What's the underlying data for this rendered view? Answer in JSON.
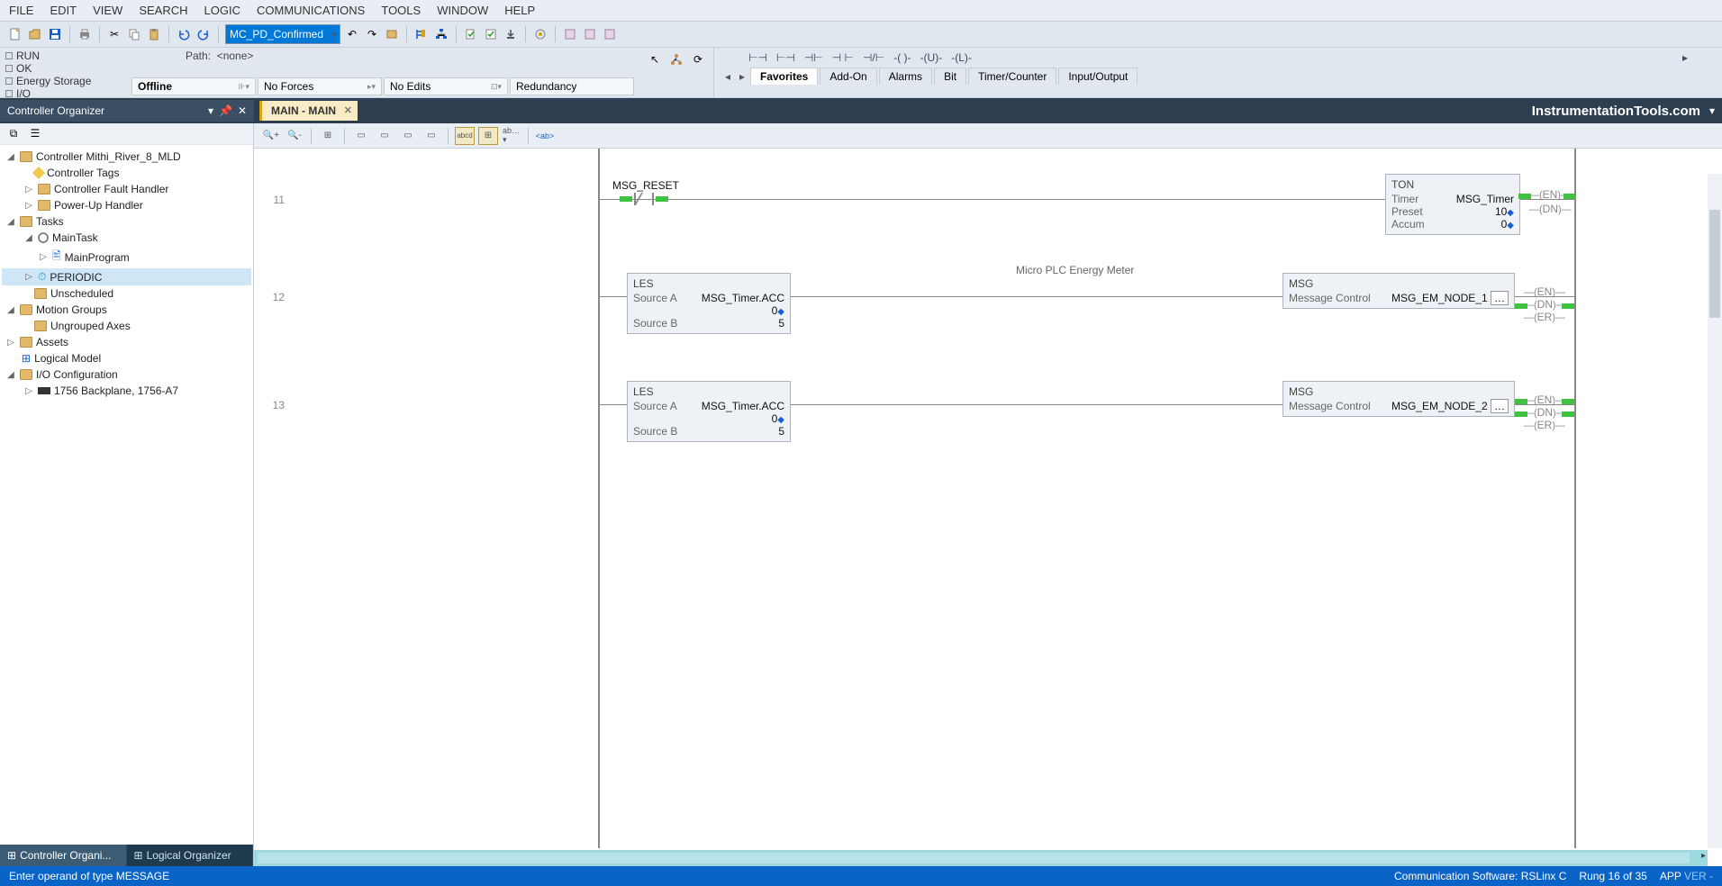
{
  "menu": {
    "items": [
      "FILE",
      "EDIT",
      "VIEW",
      "SEARCH",
      "LOGIC",
      "COMMUNICATIONS",
      "TOOLS",
      "WINDOW",
      "HELP"
    ]
  },
  "toolbar_combo": "MC_PD_Confirmed",
  "status_left": {
    "l1": "RUN",
    "l2": "OK",
    "l3": "Energy Storage",
    "l4": "I/O"
  },
  "status": {
    "path_label": "Path:",
    "path_value": "<none>",
    "offline": "Offline",
    "noforces": "No Forces",
    "noedits": "No Edits",
    "redundancy": "Redundancy"
  },
  "instruction_tabs": {
    "items": [
      "Favorites",
      "Add-On",
      "Alarms",
      "Bit",
      "Timer/Counter",
      "Input/Output"
    ],
    "active": 0
  },
  "organizer": {
    "title": "Controller Organizer"
  },
  "doc_tab": "MAIN - MAIN",
  "brand": "InstrumentationTools.com",
  "tree": {
    "n0": "Controller Mithi_River_8_MLD",
    "n1": "Controller Tags",
    "n2": "Controller Fault Handler",
    "n3": "Power-Up Handler",
    "n4": "Tasks",
    "n5": "MainTask",
    "n6": "MainProgram",
    "n7": "PERIODIC",
    "n8": "Unscheduled",
    "n9": "Motion Groups",
    "n10": "Ungrouped Axes",
    "n11": "Assets",
    "n12": "Logical Model",
    "n13": "I/O Configuration",
    "n14": "1756 Backplane, 1756-A7"
  },
  "bottom_tabs": {
    "t1": "Controller Organi...",
    "t2": "Logical Organizer"
  },
  "ladder": {
    "r11_num": "11",
    "r12_num": "12",
    "r13_num": "13",
    "msg_reset": "MSG_RESET",
    "desc": "Micro PLC Energy Meter",
    "ton": {
      "hdr": "TON",
      "timer_l": "Timer",
      "timer_v": "MSG_Timer",
      "preset_l": "Preset",
      "preset_v": "10",
      "accum_l": "Accum",
      "accum_v": "0"
    },
    "les": {
      "hdr": "LES",
      "srca_l": "Source A",
      "srca_v": "MSG_Timer.ACC",
      "srca_val": "0",
      "srcb_l": "Source B",
      "srcb_v": "5"
    },
    "msg1": {
      "hdr": "MSG",
      "ctrl_l": "Message Control",
      "ctrl_v": "MSG_EM_NODE_1"
    },
    "msg2": {
      "hdr": "MSG",
      "ctrl_l": "Message Control",
      "ctrl_v": "MSG_EM_NODE_2"
    },
    "pins": {
      "en": "EN",
      "dn": "DN",
      "er": "ER"
    }
  },
  "statusbar": {
    "prompt": "Enter operand of type MESSAGE",
    "comm": "Communication Software: RSLinx C",
    "rung": "Rung 16 of 35",
    "app": "APP",
    "ver": "VER"
  }
}
